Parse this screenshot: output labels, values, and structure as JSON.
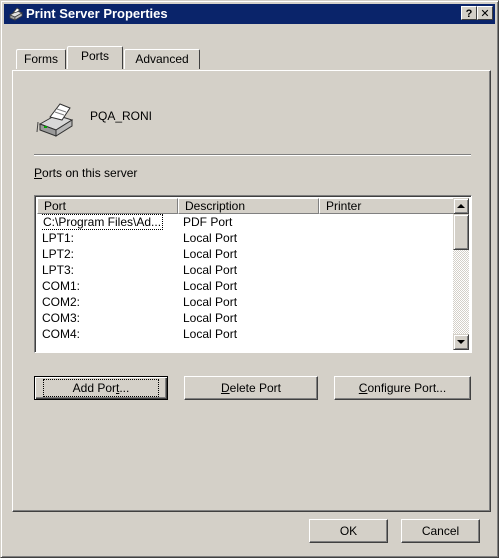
{
  "window": {
    "title": "Print Server Properties",
    "help_label": "?",
    "close_label": "✕"
  },
  "tabs": [
    {
      "label": "Forms"
    },
    {
      "label": "Ports"
    },
    {
      "label": "Advanced"
    }
  ],
  "server": {
    "name": "PQA_RONI",
    "icon": "printer-icon"
  },
  "ports_section": {
    "label_first": "P",
    "label_rest": "orts on this server",
    "columns": [
      "Port",
      "Description",
      "Printer"
    ],
    "rows": [
      {
        "port": "C:\\Program Files\\Ad...",
        "description": "PDF Port",
        "printer": ""
      },
      {
        "port": "LPT1:",
        "description": "Local Port",
        "printer": ""
      },
      {
        "port": "LPT2:",
        "description": "Local Port",
        "printer": ""
      },
      {
        "port": "LPT3:",
        "description": "Local Port",
        "printer": ""
      },
      {
        "port": "COM1:",
        "description": "Local Port",
        "printer": ""
      },
      {
        "port": "COM2:",
        "description": "Local Port",
        "printer": ""
      },
      {
        "port": "COM3:",
        "description": "Local Port",
        "printer": ""
      },
      {
        "port": "COM4:",
        "description": "Local Port",
        "printer": ""
      }
    ]
  },
  "buttons": {
    "add_port_pre": "Add Por",
    "add_port_key": "t",
    "add_port_post": "...",
    "delete_port_key": "D",
    "delete_port_post": "elete Port",
    "configure_port_key": "C",
    "configure_port_post": "onfigure Port...",
    "ok": "OK",
    "cancel": "Cancel"
  }
}
